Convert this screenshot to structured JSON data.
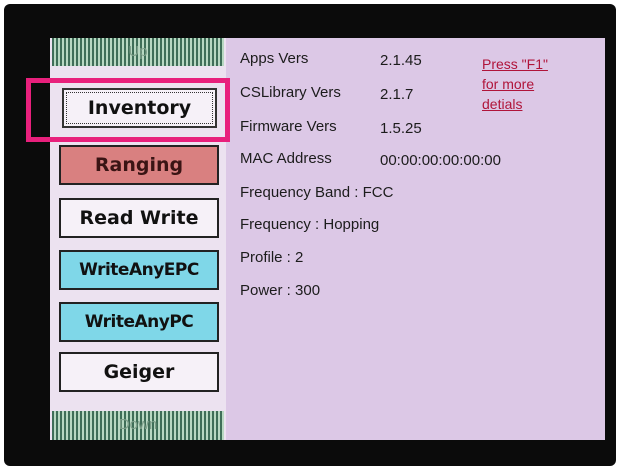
{
  "nav": {
    "up_label": "Up",
    "down_label": "Down",
    "buttons": [
      "Inventory",
      "Ranging",
      "Read Write",
      "WriteAnyEPC",
      "WriteAnyPC",
      "Geiger"
    ]
  },
  "info": {
    "apps_label": "Apps Vers",
    "apps_value": "2.1.45",
    "cslib_label": "CSLibrary Vers",
    "cslib_value": "2.1.7",
    "firmware_label": "Firmware Vers",
    "firmware_value": "1.5.25",
    "mac_label": "MAC Address",
    "mac_value": "00:00:00:00:00:00",
    "band": "Frequency Band : FCC",
    "frequency": "Frequency : Hopping",
    "profile": "Profile : 2",
    "power": "Power : 300"
  },
  "help": {
    "line1": "Press \"F1\"",
    "line2": "for more",
    "line3": "detials"
  },
  "colors": {
    "screen_bg": "#dcc8e6",
    "ranging_bg": "#d98080",
    "write_bg": "#7fd7e8",
    "highlight": "#e8207c",
    "link": "#b0143a"
  }
}
